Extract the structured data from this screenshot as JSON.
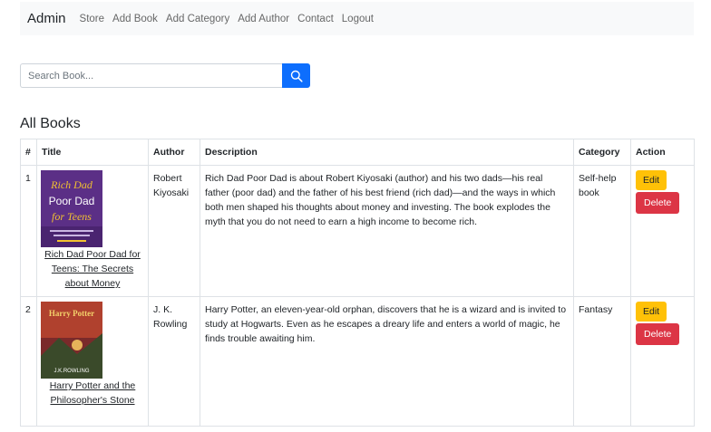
{
  "navbar": {
    "brand": "Admin",
    "links": [
      "Store",
      "Add Book",
      "Add Category",
      "Add Author",
      "Contact",
      "Logout"
    ]
  },
  "search": {
    "placeholder": "Search Book...",
    "value": ""
  },
  "section_title": "All Books",
  "table": {
    "headers": [
      "#",
      "Title",
      "Author",
      "Description",
      "Category",
      "Action"
    ],
    "rows": [
      {
        "index": "1",
        "title": "Rich Dad Poor Dad for Teens: The Secrets about Money",
        "cover_text": [
          "Rich Dad",
          "Poor Dad",
          "for Teens"
        ],
        "author": "Robert Kiyosaki",
        "description": "Rich Dad Poor Dad is about Robert Kiyosaki (author) and his two dads—his real father (poor dad) and the father of his best friend (rich dad)—and the ways in which both men shaped his thoughts about money and investing. The book explodes the myth that you do not need to earn a high income to become rich.",
        "category": "Self-help book",
        "edit": "Edit",
        "delete": "Delete"
      },
      {
        "index": "2",
        "title": "Harry Potter and the Philosopher's Stone",
        "cover_text": [
          "Harry Potter",
          "J.K.ROWLING"
        ],
        "author": "J. K. Rowling",
        "description": "Harry Potter, an eleven-year-old orphan, discovers that he is a wizard and is invited to study at Hogwarts. Even as he escapes a dreary life and enters a world of magic, he finds trouble awaiting him.",
        "category": "Fantasy",
        "edit": "Edit",
        "delete": "Delete"
      }
    ]
  },
  "colors": {
    "primary": "#0d6efd",
    "warning": "#ffc107",
    "danger": "#dc3545",
    "navbar_bg": "#f8f9fa",
    "border": "#dee2e6"
  },
  "icons": {
    "search": "search-icon"
  }
}
